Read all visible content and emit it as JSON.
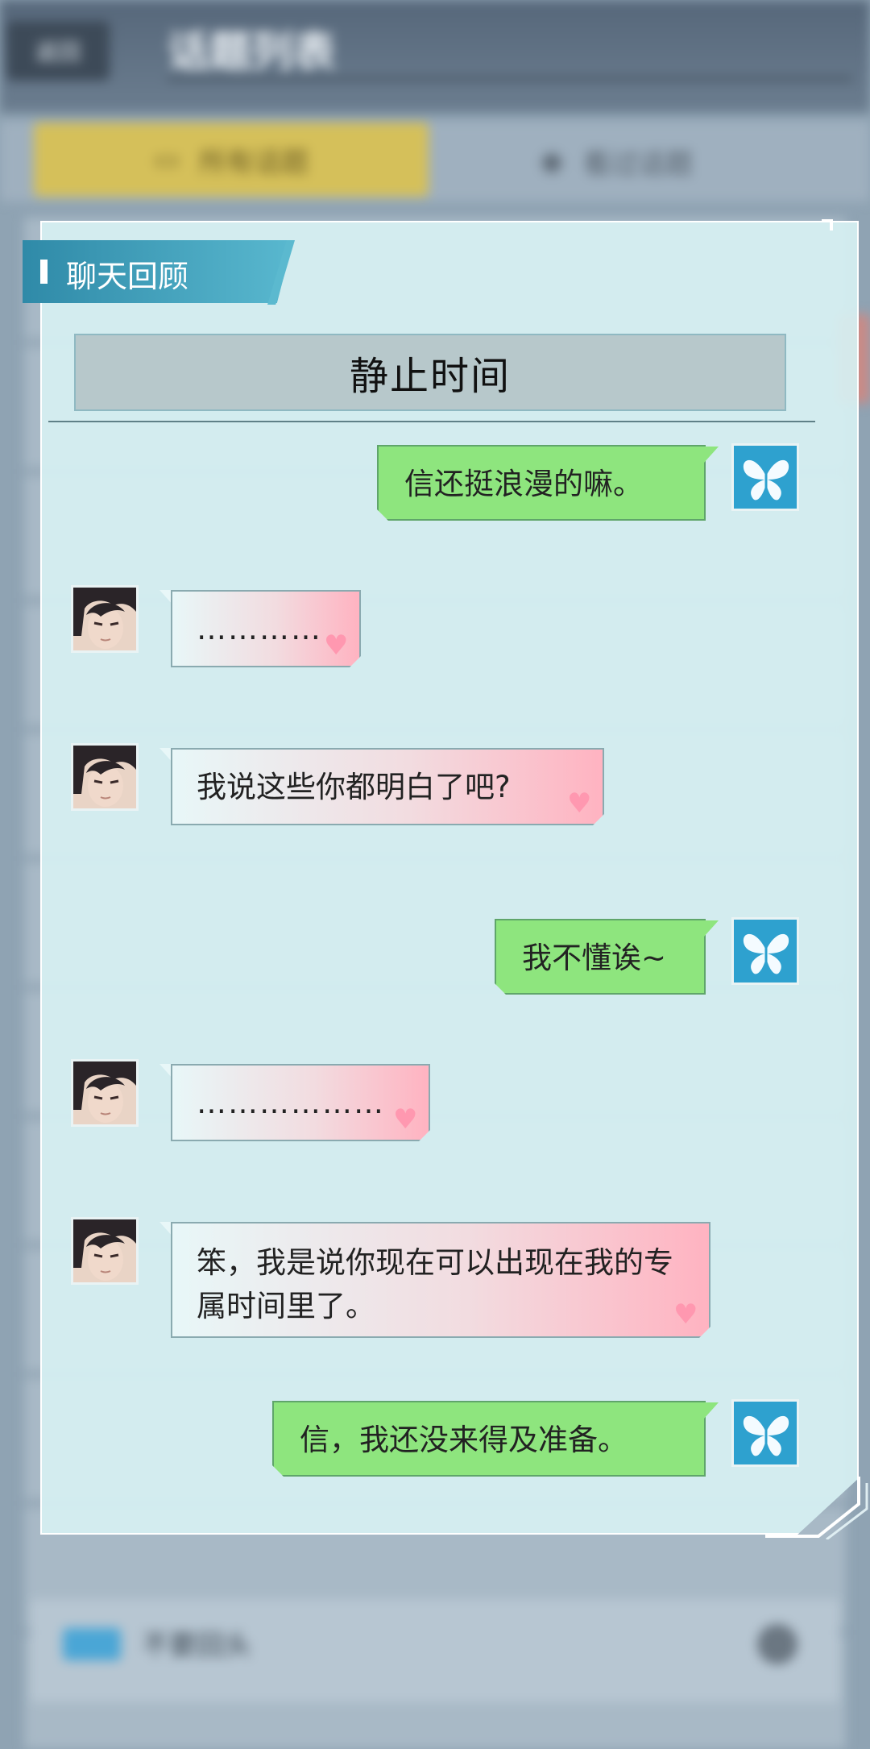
{
  "background": {
    "back_label": "返回",
    "screen_title": "话题列表",
    "tab_active": "所有话题",
    "tab_inactive": "看过话题",
    "bottom_item": "不要回头"
  },
  "panel": {
    "section_label": "聊天回顾",
    "topic_title": "静止时间"
  },
  "messages": [
    {
      "sender": "user",
      "text": "信还挺浪漫的嘛。"
    },
    {
      "sender": "npc",
      "text": "…………"
    },
    {
      "sender": "npc",
      "text": "我说这些你都明白了吧?"
    },
    {
      "sender": "user",
      "text": "我不懂诶~"
    },
    {
      "sender": "npc",
      "text": "………………"
    },
    {
      "sender": "npc",
      "text": "笨，我是说你现在可以出现在我的专属时间里了。"
    },
    {
      "sender": "user",
      "text": "信，我还没来得及准备。"
    }
  ],
  "colors": {
    "user_bubble": "#8ee57e",
    "npc_bubble_accent": "#ffb3c1",
    "panel_bg": "#d6f0f2",
    "header_accent": "#2f8aa8"
  },
  "icons": {
    "user_avatar": "butterfly-icon",
    "bubble_decoration": "heart-icon"
  }
}
